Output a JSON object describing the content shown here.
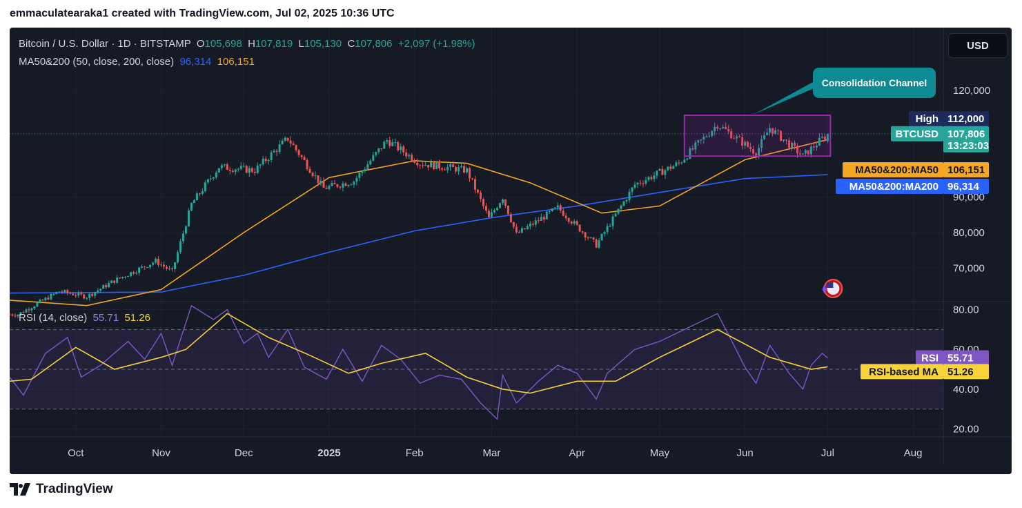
{
  "caption": "emmaculatearaka1 created with TradingView.com, Jul 02, 2025 10:36 UTC",
  "legend": {
    "symbol": "Bitcoin / U.S. Dollar · 1D · BITSTAMP",
    "open_label": "O",
    "open": "105,698",
    "high_label": "H",
    "high": "107,819",
    "low_label": "L",
    "low": "105,130",
    "close_label": "C",
    "close": "107,806",
    "change": "+2,097 (+1.98%)",
    "ma_title": "MA50&200 (50, close, 200, close)",
    "ma50_value": "96,314",
    "ma200_value": "106,151",
    "rsi_title": "RSI (14, close)",
    "rsi_value": "55.71",
    "rsi_ma_value": "51.26"
  },
  "currency_button": "USD",
  "annotation": "Consolidation Channel",
  "price_tags": {
    "high_label": "High",
    "high_value": "112,000",
    "btc_label": "BTCUSD",
    "btc_value": "107,806",
    "btc_countdown": "13:23:03",
    "ma50_label": "MA50&200:MA50",
    "ma50_value": "106,151",
    "ma200_label": "MA50&200:MA200",
    "ma200_value": "96,314",
    "rsi_label": "RSI",
    "rsi_value": "55.71",
    "rsi_ma_label": "RSI-based MA",
    "rsi_ma_value": "51.26"
  },
  "footer_brand": "TradingView",
  "colors": {
    "up": "#26a69a",
    "down": "#ef5350",
    "ma50": "#f5a623",
    "ma200": "#2962ff",
    "rsi": "#7e57c2",
    "rsi_ma": "#f7d33b",
    "channel": "#9c27b0",
    "callout": "#0e8a95"
  },
  "chart_data": [
    {
      "type": "candlestick",
      "title": "Bitcoin / U.S. Dollar · 1D · BITSTAMP",
      "x_axis_labels": [
        "Oct",
        "Nov",
        "Dec",
        "2025",
        "Feb",
        "Mar",
        "Apr",
        "May",
        "Jun",
        "Jul",
        "Aug"
      ],
      "x_range": [
        "2024-09-07",
        "2025-08-12"
      ],
      "y_ticks": [
        70000,
        80000,
        90000,
        120000
      ],
      "y_tick_labels": [
        "70,000",
        "80,000",
        "90,000",
        "120,000"
      ],
      "y_range": [
        60600,
        126000
      ],
      "close_path": [
        [
          "2024-09-10",
          57000
        ],
        [
          "2024-09-25",
          63500
        ],
        [
          "2024-10-05",
          62000
        ],
        [
          "2024-10-15",
          66500
        ],
        [
          "2024-10-30",
          72000
        ],
        [
          "2024-11-05",
          69000
        ],
        [
          "2024-11-12",
          88000
        ],
        [
          "2024-11-22",
          98500
        ],
        [
          "2024-12-05",
          97500
        ],
        [
          "2024-12-17",
          106500
        ],
        [
          "2024-12-30",
          92500
        ],
        [
          "2025-01-10",
          94500
        ],
        [
          "2025-01-22",
          106000
        ],
        [
          "2025-02-03",
          99500
        ],
        [
          "2025-02-20",
          97500
        ],
        [
          "2025-02-28",
          84000
        ],
        [
          "2025-03-05",
          90000
        ],
        [
          "2025-03-10",
          79500
        ],
        [
          "2025-03-25",
          87000
        ],
        [
          "2025-04-08",
          76500
        ],
        [
          "2025-04-22",
          93500
        ],
        [
          "2025-05-08",
          99500
        ],
        [
          "2025-05-22",
          110500
        ],
        [
          "2025-06-05",
          102500
        ],
        [
          "2025-06-10",
          109500
        ],
        [
          "2025-06-22",
          101500
        ],
        [
          "2025-07-01",
          107806
        ]
      ],
      "series": [
        {
          "name": "MA50&200:MA50",
          "points": [
            [
              "2024-09-07",
              61000
            ],
            [
              "2024-10-05",
              59500
            ],
            [
              "2024-11-01",
              64000
            ],
            [
              "2024-12-01",
              80000
            ],
            [
              "2025-01-01",
              95500
            ],
            [
              "2025-02-01",
              100200
            ],
            [
              "2025-02-20",
              99500
            ],
            [
              "2025-03-15",
              94000
            ],
            [
              "2025-04-10",
              85500
            ],
            [
              "2025-05-01",
              87500
            ],
            [
              "2025-06-01",
              100500
            ],
            [
              "2025-07-01",
              106151
            ]
          ]
        },
        {
          "name": "MA50&200:MA200",
          "points": [
            [
              "2024-09-07",
              63000
            ],
            [
              "2024-11-01",
              63300
            ],
            [
              "2024-12-01",
              68000
            ],
            [
              "2025-01-01",
              74500
            ],
            [
              "2025-02-01",
              80500
            ],
            [
              "2025-03-01",
              84200
            ],
            [
              "2025-04-01",
              87500
            ],
            [
              "2025-05-01",
              91300
            ],
            [
              "2025-06-01",
              95200
            ],
            [
              "2025-07-01",
              96314
            ]
          ]
        }
      ],
      "reference_lines": {
        "high": 112000,
        "last_price": 107806
      },
      "annotation": {
        "text": "Consolidation Channel",
        "from": "2025-05-10",
        "to": "2025-07-02",
        "low": 101500,
        "high": 113000
      }
    },
    {
      "type": "line",
      "title": "RSI (14, close)",
      "y_ticks": [
        20,
        40,
        60,
        80
      ],
      "y_tick_labels": [
        "20.00",
        "40.00",
        "60.00",
        "80.00"
      ],
      "y_range": [
        16,
        84
      ],
      "band": [
        30,
        70
      ],
      "midline": 50,
      "series": [
        {
          "name": "RSI",
          "points": [
            [
              "2024-09-07",
              46
            ],
            [
              "2024-09-12",
              37
            ],
            [
              "2024-09-20",
              58
            ],
            [
              "2024-09-28",
              66
            ],
            [
              "2024-10-03",
              46
            ],
            [
              "2024-10-10",
              52
            ],
            [
              "2024-10-20",
              64
            ],
            [
              "2024-10-26",
              55
            ],
            [
              "2024-11-01",
              68
            ],
            [
              "2024-11-05",
              52
            ],
            [
              "2024-11-12",
              82
            ],
            [
              "2024-11-20",
              75
            ],
            [
              "2024-11-25",
              80
            ],
            [
              "2024-12-01",
              63
            ],
            [
              "2024-12-06",
              68
            ],
            [
              "2024-12-10",
              56
            ],
            [
              "2024-12-17",
              70
            ],
            [
              "2024-12-23",
              51
            ],
            [
              "2024-12-31",
              45
            ],
            [
              "2025-01-06",
              60
            ],
            [
              "2025-01-13",
              44
            ],
            [
              "2025-01-20",
              62
            ],
            [
              "2025-01-27",
              55
            ],
            [
              "2025-02-03",
              43
            ],
            [
              "2025-02-10",
              47
            ],
            [
              "2025-02-18",
              45
            ],
            [
              "2025-02-25",
              33
            ],
            [
              "2025-03-03",
              25
            ],
            [
              "2025-03-05",
              47
            ],
            [
              "2025-03-10",
              33
            ],
            [
              "2025-03-18",
              44
            ],
            [
              "2025-03-25",
              52
            ],
            [
              "2025-04-01",
              48
            ],
            [
              "2025-04-08",
              35
            ],
            [
              "2025-04-12",
              48
            ],
            [
              "2025-04-22",
              60
            ],
            [
              "2025-05-01",
              64
            ],
            [
              "2025-05-10",
              70
            ],
            [
              "2025-05-22",
              78
            ],
            [
              "2025-05-28",
              62
            ],
            [
              "2025-06-01",
              51
            ],
            [
              "2025-06-05",
              43
            ],
            [
              "2025-06-10",
              62
            ],
            [
              "2025-06-17",
              48
            ],
            [
              "2025-06-22",
              40
            ],
            [
              "2025-06-25",
              52
            ],
            [
              "2025-06-29",
              58
            ],
            [
              "2025-07-01",
              55.71
            ]
          ]
        },
        {
          "name": "RSI-based MA",
          "points": [
            [
              "2024-09-07",
              44
            ],
            [
              "2024-09-15",
              45
            ],
            [
              "2024-10-01",
              61
            ],
            [
              "2024-10-15",
              50
            ],
            [
              "2024-11-01",
              56
            ],
            [
              "2024-11-10",
              60
            ],
            [
              "2024-11-25",
              78
            ],
            [
              "2024-12-10",
              66
            ],
            [
              "2024-12-25",
              57
            ],
            [
              "2025-01-08",
              48
            ],
            [
              "2025-01-20",
              53
            ],
            [
              "2025-02-05",
              58
            ],
            [
              "2025-02-20",
              46
            ],
            [
              "2025-03-05",
              40
            ],
            [
              "2025-03-15",
              38
            ],
            [
              "2025-04-01",
              44
            ],
            [
              "2025-04-15",
              44
            ],
            [
              "2025-05-01",
              56
            ],
            [
              "2025-05-22",
              70
            ],
            [
              "2025-06-10",
              56
            ],
            [
              "2025-06-25",
              50
            ],
            [
              "2025-07-01",
              51.26
            ]
          ]
        }
      ],
      "shared_x_axis_labels": [
        "Oct",
        "Nov",
        "Dec",
        "2025",
        "Feb",
        "Mar",
        "Apr",
        "May",
        "Jun",
        "Jul",
        "Aug"
      ]
    }
  ]
}
